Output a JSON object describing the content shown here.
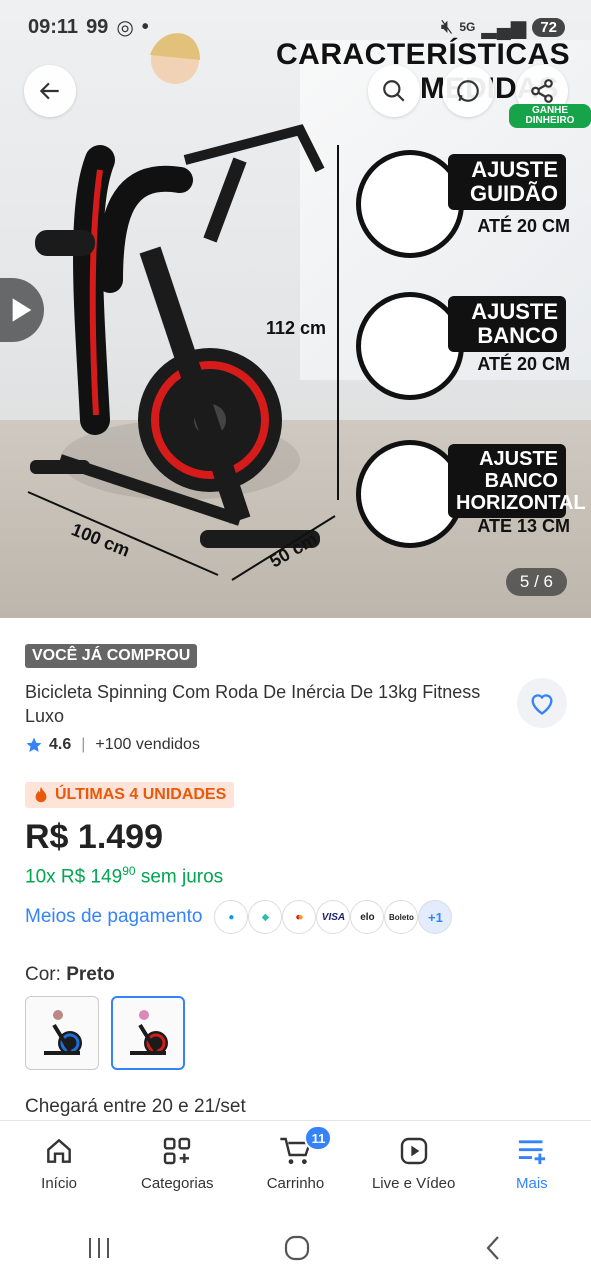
{
  "status_bar": {
    "time": "09:11",
    "notif_count": "99",
    "network": "5G",
    "battery": "72"
  },
  "hero": {
    "headline_line1": "CARACTERÍSTICAS",
    "headline_line2": "MEDIDAS",
    "features": [
      {
        "tag": "AJUSTE GUIDÃO",
        "limit": "ATÉ 20 CM"
      },
      {
        "tag": "AJUSTE BANCO",
        "limit": "ATÉ 20 CM"
      },
      {
        "tag": "AJUSTE BANCO HORIZONTAL",
        "limit": "ATÉ 13 CM"
      }
    ],
    "dimensions": {
      "height": "112 cm",
      "length": "100 cm",
      "width": "50 cm"
    },
    "ganhe_label": "GANHE DINHEIRO",
    "counter": "5 / 6"
  },
  "product": {
    "badge": "VOCÊ JÁ COMPROU",
    "title": "Bicicleta Spinning Com Roda De Inércia De 13kg Fitness Luxo",
    "rating": "4.6",
    "sold": "+100 vendidos",
    "urgency": "ÚLTIMAS 4 UNIDADES",
    "price": "R$ 1.499",
    "installments_prefix": "10x R$ 149",
    "installments_cents": "90",
    "installments_suffix": "sem juros",
    "payment_link": "Meios de pagamento",
    "payment_methods": [
      "mercadopago",
      "pix",
      "mastercard",
      "VISA",
      "elo",
      "Boleto"
    ],
    "payment_more": "+1",
    "color_label": "Cor:",
    "color_value": "Preto",
    "delivery": "Chegará entre 20 e 21/set"
  },
  "bottom_nav": [
    {
      "label": "Início",
      "icon": "home-icon"
    },
    {
      "label": "Categorias",
      "icon": "grid-plus-icon"
    },
    {
      "label": "Carrinho",
      "icon": "cart-icon",
      "badge": "11"
    },
    {
      "label": "Live e Vídeo",
      "icon": "play-icon"
    },
    {
      "label": "Mais",
      "icon": "menu-plus-icon",
      "active": true
    }
  ],
  "colors": {
    "accent": "#3483fa",
    "green": "#00a650",
    "urgency": "#e8590c"
  }
}
